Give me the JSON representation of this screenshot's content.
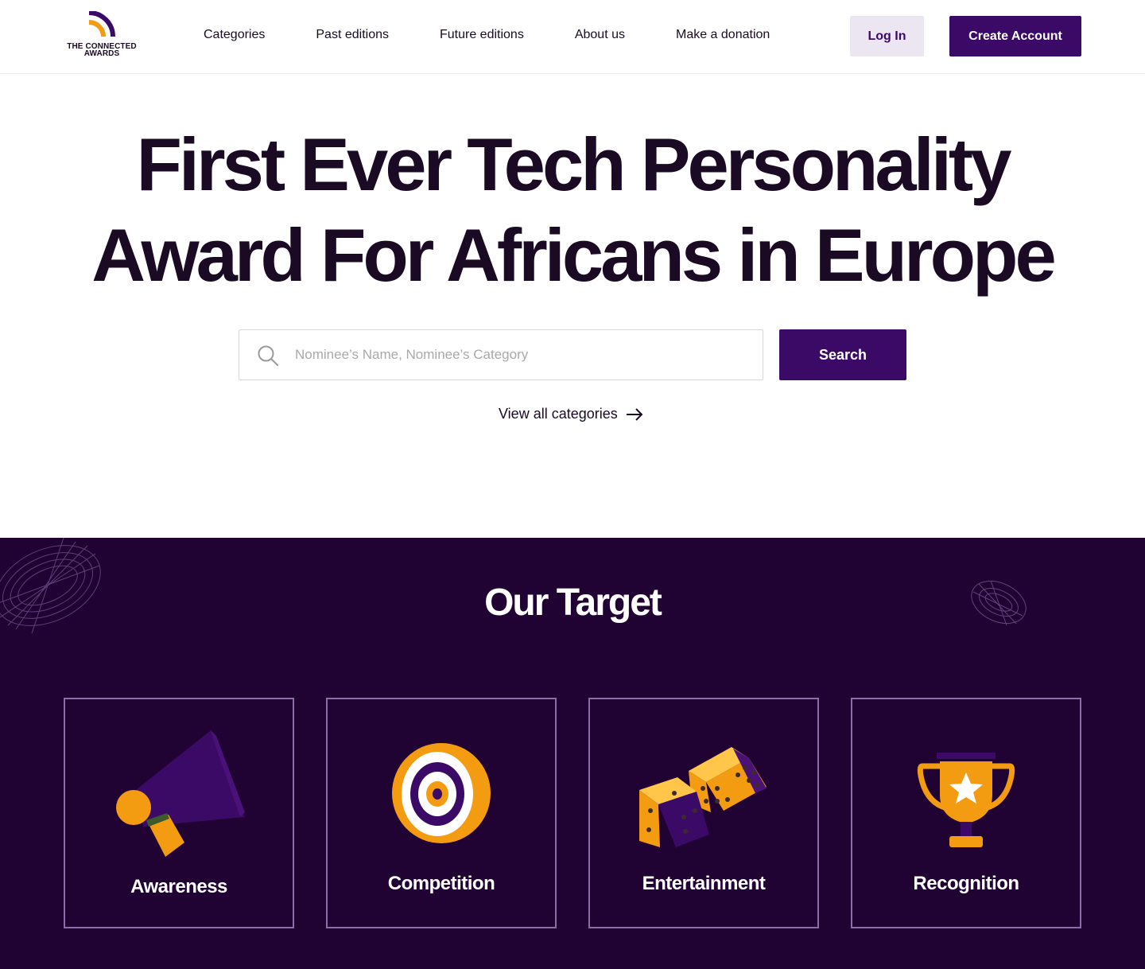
{
  "brand": {
    "line1": "THE CONNECTED",
    "line2": "AWARDS",
    "colors": {
      "primary": "#3b0a66",
      "accent": "#f39c12",
      "dark": "#200233"
    }
  },
  "nav": {
    "items": [
      {
        "label": "Categories"
      },
      {
        "label": "Past editions"
      },
      {
        "label": "Future editions"
      },
      {
        "label": "About us"
      },
      {
        "label": "Make a donation"
      }
    ]
  },
  "auth": {
    "login_label": "Log In",
    "create_label": "Create Account"
  },
  "hero": {
    "title_line1": "First Ever Tech Personality",
    "title_line2": "Award For Africans in Europe",
    "search_placeholder": "Nominee’s Name, Nominee’s Category",
    "search_value": "",
    "search_button": "Search",
    "view_all": "View all categories",
    "search_icon": "search-icon",
    "arrow_icon": "arrow-right-icon"
  },
  "target": {
    "title": "Our Target",
    "cards": [
      {
        "label": "Awareness",
        "icon": "megaphone-icon"
      },
      {
        "label": "Competition",
        "icon": "target-icon"
      },
      {
        "label": "Entertainment",
        "icon": "dice-icon"
      },
      {
        "label": "Recognition",
        "icon": "trophy-icon"
      }
    ]
  }
}
